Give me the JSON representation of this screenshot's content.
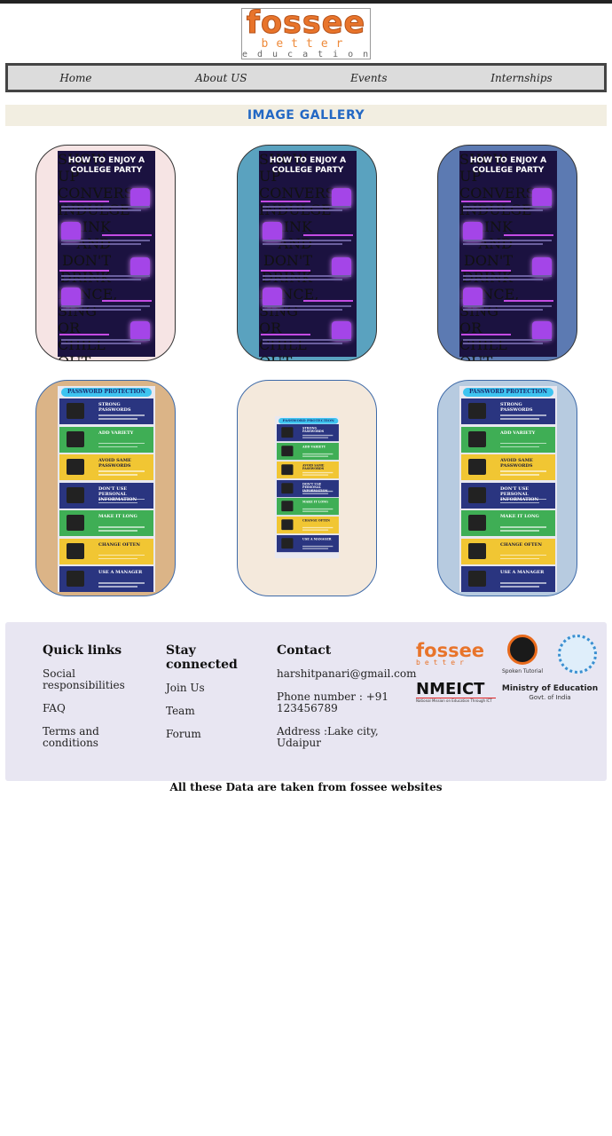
{
  "logo": {
    "word": "fossee",
    "line1": "better",
    "line2": "education"
  },
  "nav": {
    "items": [
      "Home",
      "About US",
      "Events",
      "Internships"
    ]
  },
  "gallery": {
    "title": "IMAGE GALLERY",
    "party_poster": {
      "title": "HOW TO ENJOY A COLLEGE PARTY",
      "sections": [
        "SHOW UP",
        "CONVERSE",
        "INDULGE",
        "DRINK AND DON'T DRINK",
        "DANCE, SING OR CHILL OUT"
      ]
    },
    "password_poster": {
      "title": "PASSWORD PROTECTION",
      "rows": [
        "STRONG PASSWORDS",
        "ADD VARIETY",
        "AVOID SAME PASSWORDS",
        "DON'T USE PERSONAL INFORMATION",
        "MAKE IT LONG",
        "CHANGE OFTEN",
        "USE A MANAGER"
      ]
    },
    "card_colors": [
      "#f6e4e4",
      "#5aa2bf",
      "#5c7ab2",
      "#dbb487",
      "#f4e9dc",
      "#b7cbe0"
    ]
  },
  "footer": {
    "quick_links": {
      "title": "Quick links",
      "items": [
        "Social responsibilities",
        "FAQ",
        "Terms and conditions"
      ]
    },
    "stay_connected": {
      "title": "Stay connected",
      "items": [
        "Join Us",
        "Team",
        "Forum"
      ]
    },
    "contact": {
      "title": "Contact",
      "email": "harshitpanari@gmail.com",
      "phone": "Phone number : +91 123456789",
      "address": "Address :Lake city, Udaipur"
    },
    "logos": {
      "fossee": "fossee",
      "fossee_sub": "better",
      "spoken": "Spoken Tutorial",
      "nmeict": "NMEICT",
      "nmeict_sub": "National Mission on Education Through ICT",
      "moe_line1": "Ministry of Education",
      "moe_line2": "Govt. of India"
    }
  },
  "credit": "All these Data are taken from fossee websites"
}
